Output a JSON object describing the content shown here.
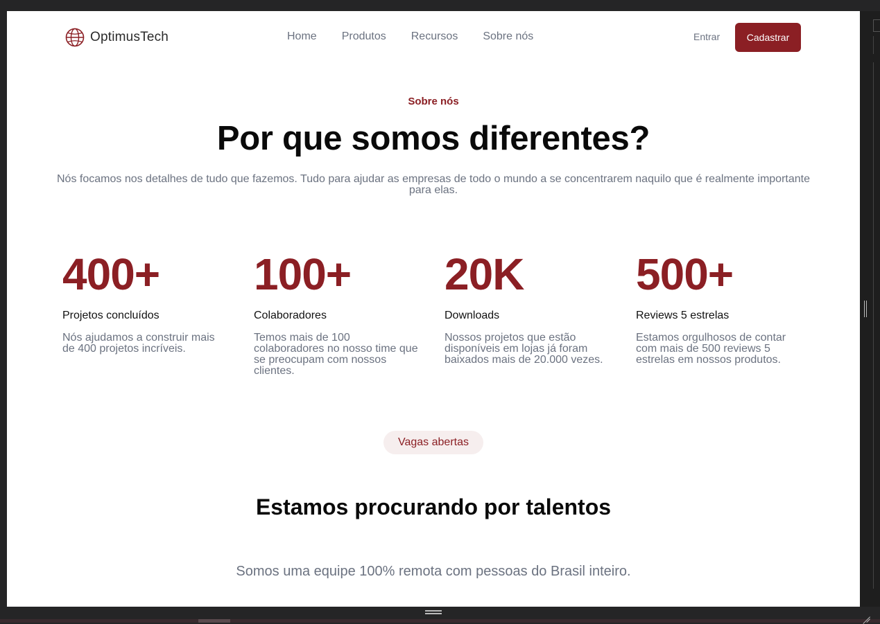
{
  "header": {
    "brand": "OptimusTech",
    "nav": [
      "Home",
      "Produtos",
      "Recursos",
      "Sobre nós"
    ],
    "login_label": "Entrar",
    "signup_label": "Cadastrar"
  },
  "about": {
    "eyebrow": "Sobre nós",
    "title": "Por que somos diferentes?",
    "lead": "Nós focamos nos detalhes de tudo que fazemos. Tudo para ajudar as empresas de todo o mundo a se concentrarem naquilo que é realmente importante para elas."
  },
  "stats": [
    {
      "value": "400+",
      "label": "Projetos concluídos",
      "desc": "Nós ajudamos a construir mais de 400 projetos incríveis."
    },
    {
      "value": "100+",
      "label": "Colaboradores",
      "desc": "Temos mais de 100 colaboradores no nosso time que se preocupam com nossos clientes."
    },
    {
      "value": "20K",
      "label": "Downloads",
      "desc": "Nossos projetos que estão disponíveis em lojas já foram baixados mais de 20.000 vezes."
    },
    {
      "value": "500+",
      "label": "Reviews 5 estrelas",
      "desc": "Estamos orgulhosos de contar com mais de 500 reviews 5 estrelas em nossos produtos."
    }
  ],
  "careers": {
    "badge": "Vagas abertas",
    "title": "Estamos procurando por talentos",
    "text": "Somos uma equipe 100% remota com pessoas do Brasil inteiro."
  },
  "colors": {
    "accent": "#8b1f24",
    "muted_text": "#6b7280",
    "badge_bg": "#f6eeee"
  },
  "icons": {
    "logo": "globe-icon"
  }
}
